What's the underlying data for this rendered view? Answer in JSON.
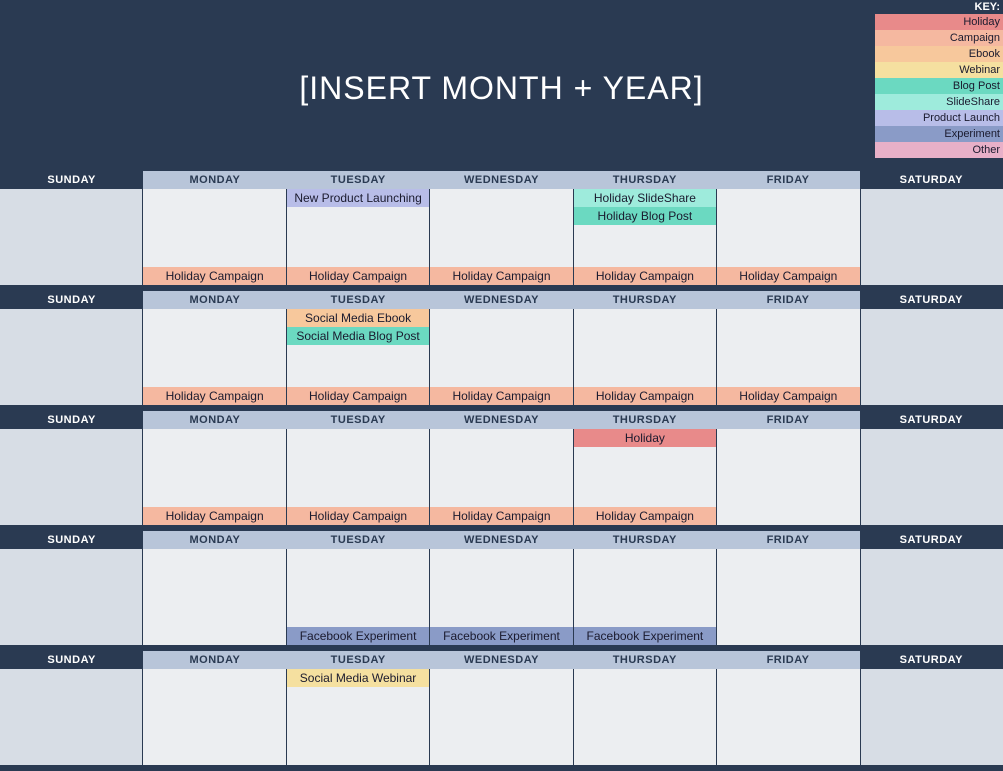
{
  "title": "[INSERT MONTH + YEAR]",
  "key": {
    "heading": "KEY:",
    "items": [
      {
        "label": "Holiday",
        "class": "c-holiday"
      },
      {
        "label": "Campaign",
        "class": "c-campaign"
      },
      {
        "label": "Ebook",
        "class": "c-ebook"
      },
      {
        "label": "Webinar",
        "class": "c-webinar"
      },
      {
        "label": "Blog Post",
        "class": "c-blogpost"
      },
      {
        "label": "SlideShare",
        "class": "c-slideshare"
      },
      {
        "label": "Product Launch",
        "class": "c-productlaunch"
      },
      {
        "label": "Experiment",
        "class": "c-experiment"
      },
      {
        "label": "Other",
        "class": "c-other"
      }
    ]
  },
  "days": [
    "SUNDAY",
    "MONDAY",
    "TUESDAY",
    "WEDNESDAY",
    "THURSDAY",
    "FRIDAY",
    "SATURDAY"
  ],
  "weeks": [
    {
      "cells": [
        {
          "top": [],
          "bottom": []
        },
        {
          "top": [],
          "bottom": [
            {
              "label": "Holiday Campaign",
              "class": "c-campaign"
            }
          ]
        },
        {
          "top": [
            {
              "label": "New Product Launching",
              "class": "c-productlaunch"
            }
          ],
          "bottom": [
            {
              "label": "Holiday Campaign",
              "class": "c-campaign"
            }
          ]
        },
        {
          "top": [],
          "bottom": [
            {
              "label": "Holiday Campaign",
              "class": "c-campaign"
            }
          ]
        },
        {
          "top": [
            {
              "label": "Holiday SlideShare",
              "class": "c-slideshare"
            },
            {
              "label": "Holiday Blog Post",
              "class": "c-blogpost"
            }
          ],
          "bottom": [
            {
              "label": "Holiday Campaign",
              "class": "c-campaign"
            }
          ]
        },
        {
          "top": [],
          "bottom": [
            {
              "label": "Holiday Campaign",
              "class": "c-campaign"
            }
          ]
        },
        {
          "top": [],
          "bottom": []
        }
      ]
    },
    {
      "cells": [
        {
          "top": [],
          "bottom": []
        },
        {
          "top": [],
          "bottom": [
            {
              "label": "Holiday Campaign",
              "class": "c-campaign"
            }
          ]
        },
        {
          "top": [
            {
              "label": "Social Media Ebook",
              "class": "c-ebook"
            },
            {
              "label": "Social Media Blog Post",
              "class": "c-blogpost"
            }
          ],
          "bottom": [
            {
              "label": "Holiday Campaign",
              "class": "c-campaign"
            }
          ]
        },
        {
          "top": [],
          "bottom": [
            {
              "label": "Holiday Campaign",
              "class": "c-campaign"
            }
          ]
        },
        {
          "top": [],
          "bottom": [
            {
              "label": "Holiday Campaign",
              "class": "c-campaign"
            }
          ]
        },
        {
          "top": [],
          "bottom": [
            {
              "label": "Holiday Campaign",
              "class": "c-campaign"
            }
          ]
        },
        {
          "top": [],
          "bottom": []
        }
      ]
    },
    {
      "cells": [
        {
          "top": [],
          "bottom": []
        },
        {
          "top": [],
          "bottom": [
            {
              "label": "Holiday Campaign",
              "class": "c-campaign"
            }
          ]
        },
        {
          "top": [],
          "bottom": [
            {
              "label": "Holiday Campaign",
              "class": "c-campaign"
            }
          ]
        },
        {
          "top": [],
          "bottom": [
            {
              "label": "Holiday Campaign",
              "class": "c-campaign"
            }
          ]
        },
        {
          "top": [
            {
              "label": "Holiday",
              "class": "c-holiday"
            }
          ],
          "bottom": [
            {
              "label": "Holiday Campaign",
              "class": "c-campaign"
            }
          ]
        },
        {
          "top": [],
          "bottom": []
        },
        {
          "top": [],
          "bottom": []
        }
      ]
    },
    {
      "cells": [
        {
          "top": [],
          "bottom": []
        },
        {
          "top": [],
          "bottom": []
        },
        {
          "top": [],
          "bottom": [
            {
              "label": "Facebook Experiment",
              "class": "c-experiment"
            }
          ]
        },
        {
          "top": [],
          "bottom": [
            {
              "label": "Facebook Experiment",
              "class": "c-experiment"
            }
          ]
        },
        {
          "top": [],
          "bottom": [
            {
              "label": "Facebook Experiment",
              "class": "c-experiment"
            }
          ]
        },
        {
          "top": [],
          "bottom": []
        },
        {
          "top": [],
          "bottom": []
        }
      ]
    },
    {
      "cells": [
        {
          "top": [],
          "bottom": []
        },
        {
          "top": [],
          "bottom": []
        },
        {
          "top": [
            {
              "label": "Social Media Webinar",
              "class": "c-webinar"
            }
          ],
          "bottom": []
        },
        {
          "top": [],
          "bottom": []
        },
        {
          "top": [],
          "bottom": []
        },
        {
          "top": [],
          "bottom": []
        },
        {
          "top": [],
          "bottom": []
        }
      ]
    }
  ]
}
